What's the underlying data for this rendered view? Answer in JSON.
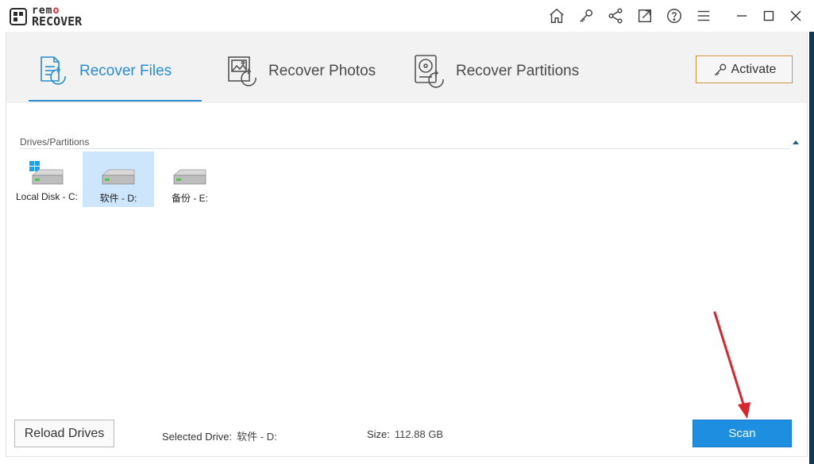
{
  "app": {
    "logo_top": "rem",
    "logo_top_o": "o",
    "logo_bottom": "RECOVER"
  },
  "titlebar": {
    "icons": [
      "home-icon",
      "key-icon",
      "share-icon",
      "external-link-icon",
      "help-icon",
      "menu-icon"
    ],
    "window_controls": [
      "minimize-icon",
      "maximize-icon",
      "close-icon"
    ]
  },
  "tabs": [
    {
      "label": "Recover Files",
      "icon": "file-recover-icon",
      "active": true
    },
    {
      "label": "Recover Photos",
      "icon": "photo-recover-icon",
      "active": false
    },
    {
      "label": "Recover Partitions",
      "icon": "partition-recover-icon",
      "active": false
    }
  ],
  "activate": {
    "label": "Activate",
    "icon": "key-icon"
  },
  "drives_section": {
    "title": "Drives/Partitions",
    "drives": [
      {
        "label": "Local Disk - C:",
        "system": true,
        "selected": false
      },
      {
        "label": "软件 - D:",
        "system": false,
        "selected": true
      },
      {
        "label": "备份 - E:",
        "system": false,
        "selected": false
      }
    ]
  },
  "bottom": {
    "reload_label": "Reload Drives",
    "selected_drive_label": "Selected Drive:",
    "selected_drive_value": "软件 - D:",
    "size_label": "Size:",
    "size_value": "112.88 GB",
    "scan_label": "Scan"
  },
  "colors": {
    "accent": "#2a8ccf",
    "scan_button": "#1e8ee0",
    "activate_border": "#c9903f",
    "selected_drive": "#cde6fb",
    "annotation_arrow": "#d9262c"
  }
}
